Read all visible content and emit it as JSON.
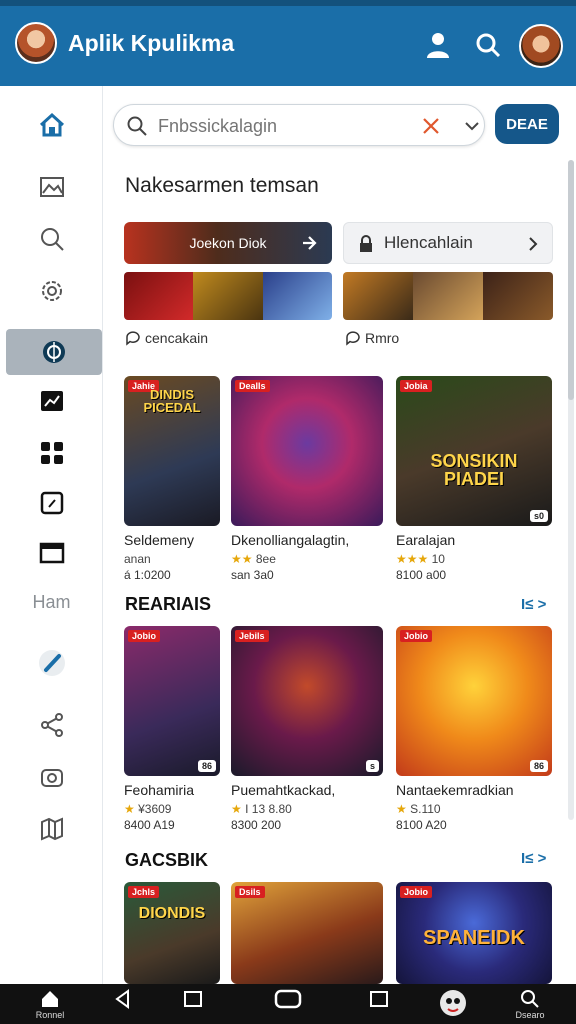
{
  "app": {
    "title": "Aplik Kpulikma"
  },
  "search": {
    "placeholder": "Fnbssickalagin"
  },
  "deal_button": "DEAE",
  "section_title": "Nakesarmen temsan",
  "promo": {
    "left_label": "Joekon Diok",
    "right_label": "Hlencahlain"
  },
  "chips": [
    "cencakain",
    "Rmro"
  ],
  "sidebar": {
    "label": "Ham"
  },
  "row1": {
    "cards": [
      {
        "tag": "Jahie",
        "art": "DINDIS PICEDAL",
        "name": "Seldemeny",
        "line2": "anan",
        "price": "á 1:0200",
        "badge": ""
      },
      {
        "tag": "Dealls",
        "art": "",
        "name": "Dkenolliangalagtin,",
        "rating": "★★",
        "rating_text": "8ee",
        "price": "san 3a0",
        "badge": ""
      },
      {
        "tag": "Jobia",
        "art": "SONSIKIN PIADEI",
        "name": "Earalajan",
        "rating": "★★★",
        "rating_text": "10",
        "price": "8100 a00",
        "badge": "s0"
      }
    ]
  },
  "row2": {
    "title": "REARIAIS",
    "more": "I≤ >",
    "cards": [
      {
        "tag": "Jobio",
        "name": "Feohamiria",
        "rating": "★",
        "rating_text": "¥3609",
        "price": "8400 A19",
        "badge": "86"
      },
      {
        "tag": "Jebils",
        "name": "Puemahtkackad,",
        "rating": "★",
        "rating_text": "I 13 8.80",
        "price": "8300 200",
        "badge": "s"
      },
      {
        "tag": "Jobio",
        "name": "Nantaekemradkian",
        "rating": "★",
        "rating_text": "S.110",
        "price": "8100 A20",
        "badge": "86"
      }
    ]
  },
  "row3": {
    "title": "GACSBIK",
    "more": "I≤ >",
    "cards": [
      {
        "tag": "Jchls",
        "art": "DIONDIS"
      },
      {
        "tag": "Dsils",
        "art": ""
      },
      {
        "tag": "Jobio",
        "art": "SPANEIDK"
      }
    ]
  },
  "bottom_nav": {
    "home": "Ronnel",
    "search": "Dsearo"
  }
}
